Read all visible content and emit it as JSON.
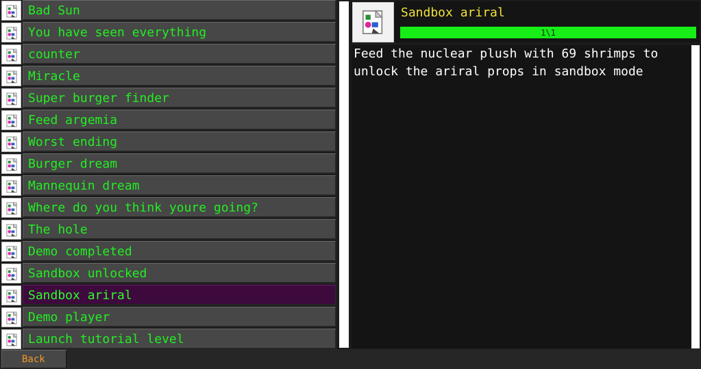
{
  "achievements": [
    {
      "label": "Bad Sun",
      "icon": "achievement-icon"
    },
    {
      "label": "You have seen everything",
      "icon": "achievement-icon"
    },
    {
      "label": "counter",
      "icon": "achievement-icon"
    },
    {
      "label": "Miracle",
      "icon": "achievement-icon"
    },
    {
      "label": "Super burger finder",
      "icon": "achievement-icon"
    },
    {
      "label": "Feed argemia",
      "icon": "achievement-icon"
    },
    {
      "label": "Worst ending",
      "icon": "achievement-icon"
    },
    {
      "label": "Burger dream",
      "icon": "achievement-icon"
    },
    {
      "label": "Mannequin dream",
      "icon": "achievement-icon"
    },
    {
      "label": "Where do you think youre going?",
      "icon": "achievement-icon"
    },
    {
      "label": "The hole",
      "icon": "achievement-icon"
    },
    {
      "label": "Demo completed",
      "icon": "achievement-icon"
    },
    {
      "label": "Sandbox unlocked",
      "icon": "achievement-icon"
    },
    {
      "label": "Sandbox ariral",
      "icon": "achievement-icon",
      "selected": true
    },
    {
      "label": "Demo player",
      "icon": "achievement-icon"
    },
    {
      "label": "Launch tutorial level",
      "icon": "achievement-icon"
    }
  ],
  "detail": {
    "title": "Sandbox ariral",
    "icon": "achievement-icon",
    "progress_text": "1\\1",
    "progress_fraction": 1.0,
    "description": "Feed the nuclear plush with 69 shrimps to\nunlock the ariral props in sandbox mode"
  },
  "footer": {
    "back_label": "Back"
  },
  "colors": {
    "label_green": "#22ee22",
    "title_yellow": "#f0e23a",
    "progress_green": "#17ee17",
    "selected_row": "#3e0a3e",
    "back_orange": "#f09a2a"
  }
}
